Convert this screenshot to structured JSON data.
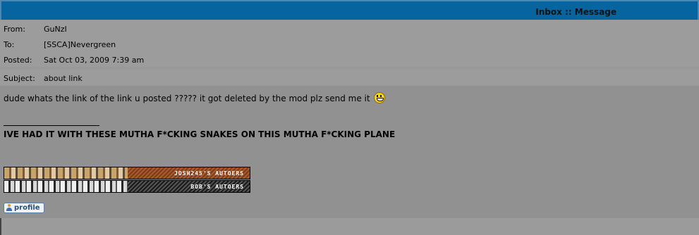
{
  "header": {
    "title": "Inbox :: Message"
  },
  "meta": {
    "from_label": "From:",
    "from_value": "GuNzI",
    "to_label": "To:",
    "to_value": "[SSCA]Nevergreen",
    "posted_label": "Posted:",
    "posted_value": "Sat Oct 03, 2009 7:39 am",
    "subject_label": "Subject:",
    "subject_value": "about link"
  },
  "message": {
    "body": "dude whats the link of the link u posted ????? it got deleted by the mod plz send me it",
    "smiley": "smiley-icon"
  },
  "signature": {
    "text": "IVE HAD IT WITH THESE MUTHA F*CKING SNAKES ON THIS MUTHA F*CKING PLANE",
    "banners": [
      {
        "label": "JOSH245'S AUTOERS"
      },
      {
        "label": "BOB'S AUTOERS"
      }
    ]
  },
  "actions": {
    "profile_label": "profile"
  }
}
